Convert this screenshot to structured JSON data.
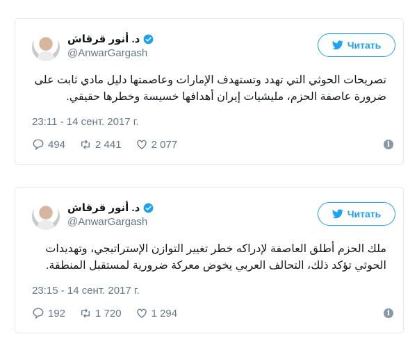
{
  "tweets": [
    {
      "name": "د. أنور قرقاش",
      "handle": "@AnwarGargash",
      "follow_label": "Читать",
      "text": "تصريحات الحوثي التي تهدد وتستهدف الإمارات وعاصمتها دليل مادي ثابت على ضرورة عاصفة الحزم، مليشيات إيران أهدافها خسيسة وخطرها حقيقي.",
      "timestamp": "23:11 - 14 сент. 2017 г.",
      "replies": "494",
      "retweets": "2 441",
      "likes": "2 077"
    },
    {
      "name": "د. أنور قرقاش",
      "handle": "@AnwarGargash",
      "follow_label": "Читать",
      "text": "ملك الحزم أطلق العاصفة لإدراكه خطر تغيير التوازن الإستراتيجي، وتهديدات الحوثي تؤكد ذلك، التحالف العربي يخوض معركة ضرورية لمستقبل المنطقة.",
      "timestamp": "23:15 - 14 сент. 2017 г.",
      "replies": "192",
      "retweets": "1 720",
      "likes": "1 294"
    }
  ],
  "colors": {
    "accent": "#1da1f2",
    "muted": "#657786",
    "border": "#e1e8ed"
  },
  "icons": [
    "verified-icon",
    "twitter-bird-icon",
    "reply-icon",
    "retweet-icon",
    "like-icon",
    "info-icon"
  ]
}
